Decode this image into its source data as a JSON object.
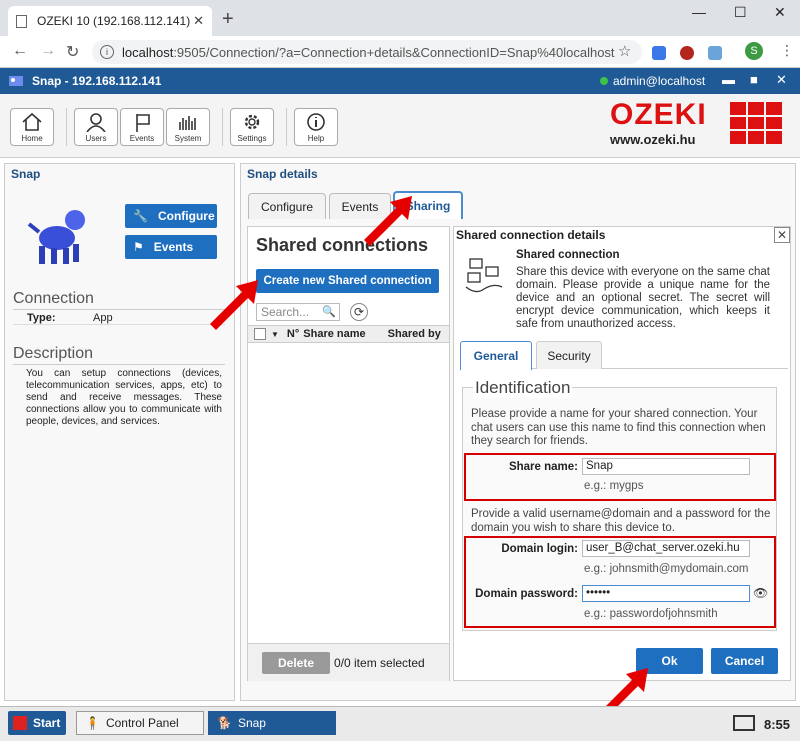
{
  "browser": {
    "tab_title": "OZEKI 10 (192.168.112.141)",
    "url_host": "localhost",
    "url_rest": ":9505/Connection/?a=Connection+details&ConnectionID=Snap%40localhost",
    "profile_initial": "S"
  },
  "app": {
    "title": "Snap - 192.168.112.141",
    "user": "admin@localhost"
  },
  "toolbar": {
    "home": "Home",
    "users": "Users",
    "events": "Events",
    "system": "System",
    "settings": "Settings",
    "help": "Help"
  },
  "brand": {
    "name": "OZEKI",
    "url": "www.ozeki.hu"
  },
  "left": {
    "title": "Snap",
    "configure_label": "Configure",
    "events_label": "Events",
    "connection_heading": "Connection",
    "type_key": "Type:",
    "type_value": "App",
    "description_heading": "Description",
    "description_text": "You can setup connections (devices, telecommunication services, apps, etc) to send and receive messages. These connections allow you to communicate with people, devices, and services."
  },
  "right": {
    "title": "Snap details",
    "tabs": [
      "Configure",
      "Events",
      "Sharing"
    ]
  },
  "shared_list": {
    "title": "Shared connections",
    "create_label": "Create new Shared connection",
    "search_placeholder": "Search...",
    "col_no": "N°",
    "col_name": "Share name",
    "col_shared_by": "Shared by",
    "delete_label": "Delete",
    "selected_text": "0/0 item selected"
  },
  "details": {
    "title": "Shared connection details",
    "heading": "Shared connection",
    "intro": "Share this device with everyone on the same chat domain. Please provide a unique name for the device and an optional secret. The secret will encrypt device communication, which keeps it safe from unauthorized access.",
    "subtabs": [
      "General",
      "Security"
    ],
    "legend": "Identification",
    "text1": "Please provide a name for your shared connection. Your chat users can use this name to find this connection when they search for friends.",
    "share_name_label": "Share name:",
    "share_name_value": "Snap",
    "share_name_hint": "e.g.: mygps",
    "text2": "Provide a valid username@domain and a password for the domain you wish to share this device to.",
    "domain_login_label": "Domain login:",
    "domain_login_value": "user_B@chat_server.ozeki.hu",
    "domain_login_hint": "e.g.: johnsmith@mydomain.com",
    "domain_password_label": "Domain password:",
    "domain_password_value": "••••••",
    "domain_password_hint": "e.g.: passwordofjohnsmith",
    "ok_label": "Ok",
    "cancel_label": "Cancel"
  },
  "taskbar": {
    "start": "Start",
    "control_panel": "Control Panel",
    "snap": "Snap",
    "clock": "8:55"
  },
  "colors": {
    "accent": "#1f6fc0",
    "titlebar": "#1f5a96",
    "highlight_red": "#d40000"
  }
}
